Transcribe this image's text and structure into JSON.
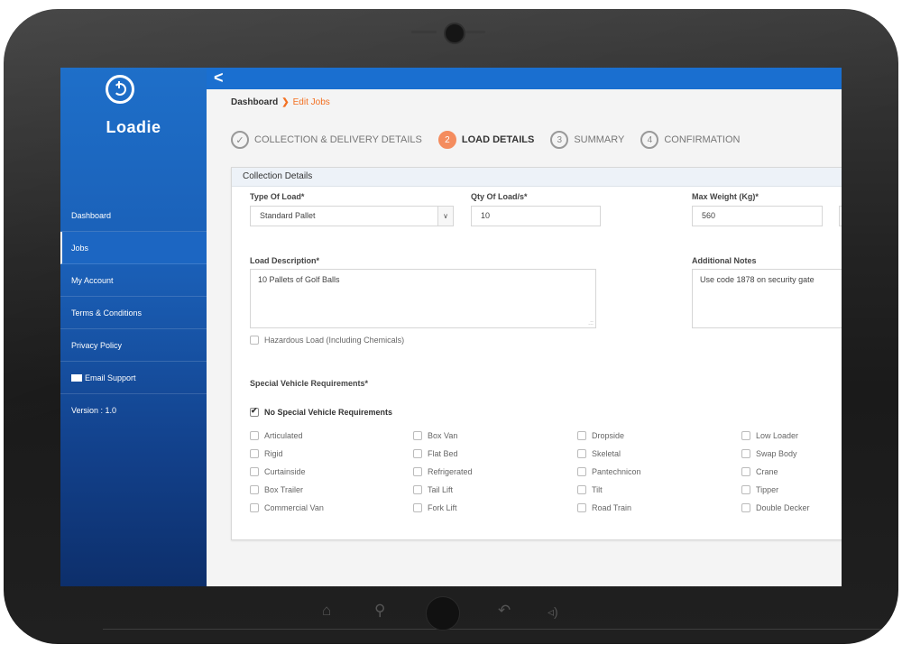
{
  "sidebar": {
    "logo_text": "Loadie",
    "items": [
      {
        "label": "Dashboard"
      },
      {
        "label": "Jobs"
      },
      {
        "label": "My Account"
      },
      {
        "label": "Terms & Conditions"
      },
      {
        "label": "Privacy Policy"
      },
      {
        "label": "Email Support",
        "icon": "mail-icon"
      },
      {
        "label": "Version : 1.0"
      }
    ],
    "active_item": "Jobs"
  },
  "topbar": {
    "back_icon": "chevron-left-icon"
  },
  "breadcrumb": {
    "home": "Dashboard",
    "separator": "❯",
    "current": "Edit Jobs"
  },
  "steps": [
    {
      "marker": "✓",
      "label": "COLLECTION & DELIVERY DETAILS",
      "state": "done"
    },
    {
      "marker": "2",
      "label": "LOAD DETAILS",
      "state": "current"
    },
    {
      "marker": "3",
      "label": "SUMMARY",
      "state": "upcoming"
    },
    {
      "marker": "4",
      "label": "CONFIRMATION",
      "state": "upcoming"
    }
  ],
  "panel": {
    "title": "Collection Details",
    "type_of_load": {
      "label": "Type Of Load*",
      "value": "Standard Pallet"
    },
    "qty": {
      "label": "Qty Of Load/s*",
      "value": "10"
    },
    "max_weight": {
      "label": "Max Weight (Kg)*",
      "value": "560"
    },
    "load_description": {
      "label": "Load Description*",
      "value": "10 Pallets of Golf Balls"
    },
    "additional_notes": {
      "label": "Additional Notes",
      "value": "Use code 1878 on security gate"
    },
    "hazardous": {
      "label": "Hazardous Load (Including Chemicals)",
      "checked": false
    },
    "special_title": "Special Vehicle Requirements*",
    "no_special": {
      "label": "No Special Vehicle Requirements",
      "checked": true
    },
    "vehicles": [
      [
        "Articulated",
        "Box Van",
        "Dropside",
        "Low Loader"
      ],
      [
        "Rigid",
        "Flat Bed",
        "Skeletal",
        "Swap Body"
      ],
      [
        "Curtainside",
        "Refrigerated",
        "Pantechnicon",
        "Crane"
      ],
      [
        "Box Trailer",
        "Tail Lift",
        "Tilt",
        "Tipper"
      ],
      [
        "Commercial Van",
        "Fork Lift",
        "Road Train",
        "Double Decker"
      ]
    ]
  },
  "colors": {
    "primary": "#1a6fd0",
    "accent": "#f37021",
    "sidebar": "#1a5eb5"
  }
}
